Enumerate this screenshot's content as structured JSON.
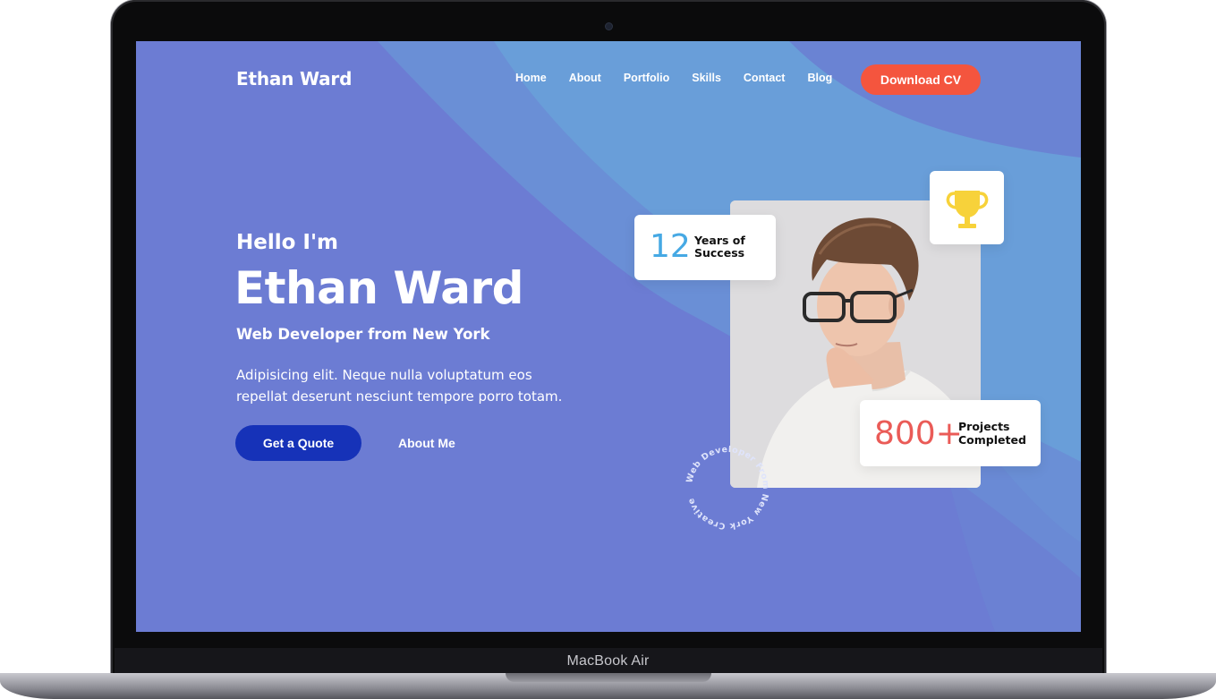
{
  "device": {
    "label": "MacBook Air"
  },
  "site": {
    "logo": "Ethan Ward",
    "nav": [
      "Home",
      "About",
      "Portfolio",
      "Skills",
      "Contact",
      "Blog"
    ],
    "cta": "Download CV"
  },
  "hero": {
    "greeting": "Hello I'm",
    "name": "Ethan Ward",
    "subtitle": "Web Developer from New York",
    "description": "Adipisicing elit. Neque nulla voluptatum eos repellat deserunt nesciunt tempore porro totam.",
    "primary_button": "Get a Quote",
    "secondary_link": "About Me"
  },
  "stats": {
    "years_value": "12",
    "years_label_line1": "Years of",
    "years_label_line2": "Success",
    "projects_value": "800+",
    "projects_label_line1": "Projects",
    "projects_label_line2": "Completed"
  },
  "badge": {
    "circular_text": "Web Developer From New York Creative"
  },
  "icons": {
    "trophy": "trophy-icon"
  },
  "colors": {
    "background": "#6d7dd4",
    "cta": "#f4553e",
    "primary_button": "#1632b8",
    "years_accent": "#46a9e4",
    "projects_accent": "#ea5b57",
    "trophy": "#f7d23a"
  }
}
